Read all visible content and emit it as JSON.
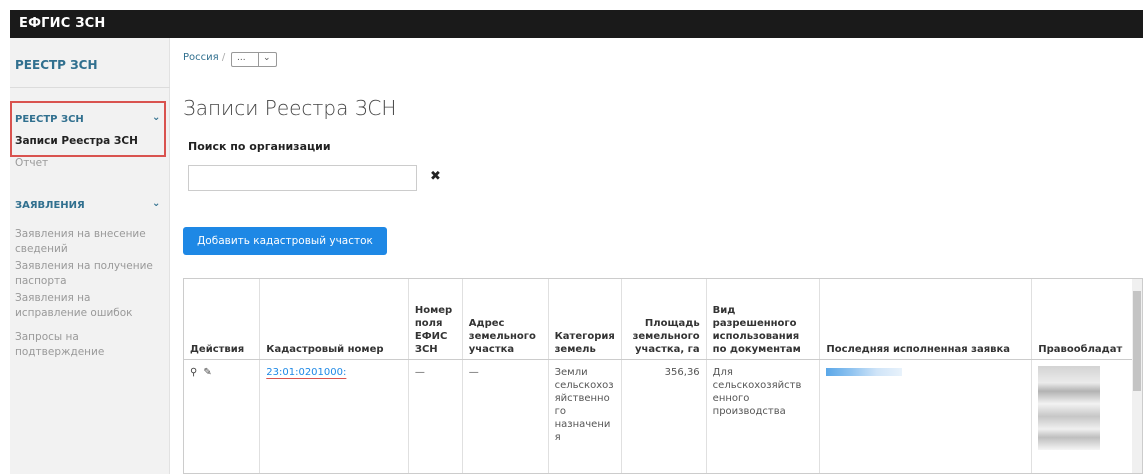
{
  "app": {
    "brand": "ЕФГИС ЗСН"
  },
  "sidebar": {
    "title": "РЕЕСТР ЗСН",
    "sections": [
      {
        "label": "РЕЕСТР ЗСН",
        "items": [
          "Записи Реестра ЗСН",
          "Отчет"
        ]
      },
      {
        "label": "ЗАЯВЛЕНИЯ",
        "items": [
          "Заявления на внесение сведений",
          "Заявления на получение паспорта",
          "Заявления на исправление ошибок",
          "Запросы на подтверждение"
        ]
      }
    ]
  },
  "breadcrumb": {
    "root": "Россия",
    "separator": "/",
    "dropdown": "..."
  },
  "page": {
    "title": "Записи Реестра ЗСН",
    "search_label": "Поиск по организации",
    "search_value": "",
    "add_button": "Добавить кадастровый участок"
  },
  "table": {
    "columns": [
      "Действия",
      "Кадастровый номер",
      "Номер поля ЕФИС ЗСН",
      "Адрес земельного участка",
      "Категория земель",
      "Площадь земельного участка, га",
      "Вид разрешенного использования по документам",
      "Последняя исполненная заявка",
      "Правообладат"
    ],
    "rows": [
      {
        "cadastral": "23:01:0201000:",
        "field_number": "—",
        "address": "—",
        "category": "Земли сельскохоз яйственно го назначени я",
        "area": "356,36",
        "usage": "Для сельскохозяйств енного производства"
      }
    ]
  }
}
